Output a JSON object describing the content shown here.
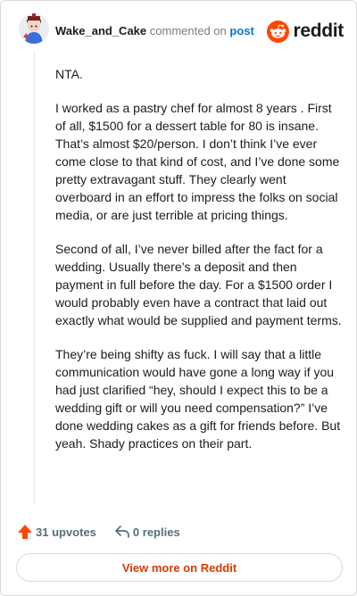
{
  "comment": {
    "username": "Wake_and_Cake",
    "commented_text": "commented on",
    "post_link": "post"
  },
  "brand": {
    "wordmark": "reddit",
    "icon": "reddit-snoo-icon",
    "color": "#ff4500"
  },
  "body": {
    "paragraphs": [
      "NTA.",
      "I worked as a pastry chef for almost 8 years . First of all, $1500 for a dessert table for 80 is insane. That’s almost $20/person. I don’t think I’ve ever come close to that kind of cost, and I’ve done some pretty extravagant stuff. They clearly went overboard in an effort to impress the folks on social media, or are just terrible at pricing things.",
      "Second of all, I’ve never billed after the fact for a wedding. Usually there’s a deposit and then payment in full before the day. For a $1500 order I would probably even have a contract that laid out exactly what would be supplied and payment terms.",
      "They’re being shifty as fuck. I will say that a little communication would have gone a long way if you had just clarified “hey, should I expect this to be a wedding gift or will you need compensation?” I’ve done wedding cakes as a gift for friends before. But yeah. Shady practices on their part."
    ]
  },
  "actions": {
    "upvotes": "31 upvotes",
    "replies": "0 replies",
    "upvote_icon": "upvote-arrow-icon",
    "reply_icon": "reply-arrow-icon",
    "upvote_color": "#ff4500"
  },
  "view_more": {
    "label": "View more on Reddit",
    "color": "#d93a00"
  }
}
